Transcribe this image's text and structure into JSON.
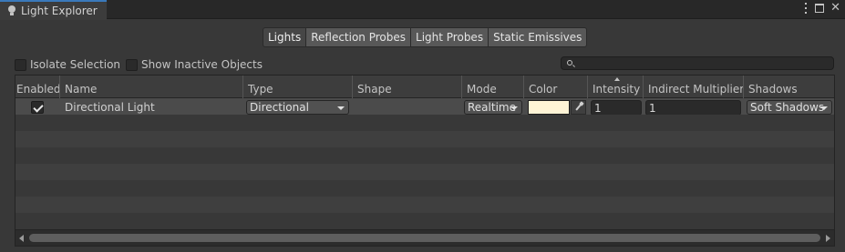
{
  "window": {
    "tab_title": "Light Explorer",
    "tab_icon": "lightbulb-icon",
    "accent_color": "#3a79bb"
  },
  "categories": [
    {
      "label": "Lights",
      "active": true
    },
    {
      "label": "Reflection Probes",
      "active": false
    },
    {
      "label": "Light Probes",
      "active": false
    },
    {
      "label": "Static Emissives",
      "active": false
    }
  ],
  "options": {
    "isolate_selection": {
      "label": "Isolate Selection",
      "checked": false
    },
    "show_inactive": {
      "label": "Show Inactive Objects",
      "checked": false
    },
    "search": {
      "value": "",
      "placeholder": ""
    }
  },
  "table": {
    "columns": [
      "Enabled",
      "Name",
      "Type",
      "Shape",
      "Mode",
      "Color",
      "Intensity",
      "Indirect Multiplier",
      "Shadows"
    ],
    "sorted_column": "Intensity",
    "rows": [
      {
        "enabled": true,
        "name": "Directional Light",
        "type": "Directional",
        "shape": "",
        "mode": "Realtime",
        "color": "#fff4d6",
        "intensity": "1",
        "indirect_multiplier": "1",
        "shadows": "Soft Shadows"
      }
    ]
  }
}
